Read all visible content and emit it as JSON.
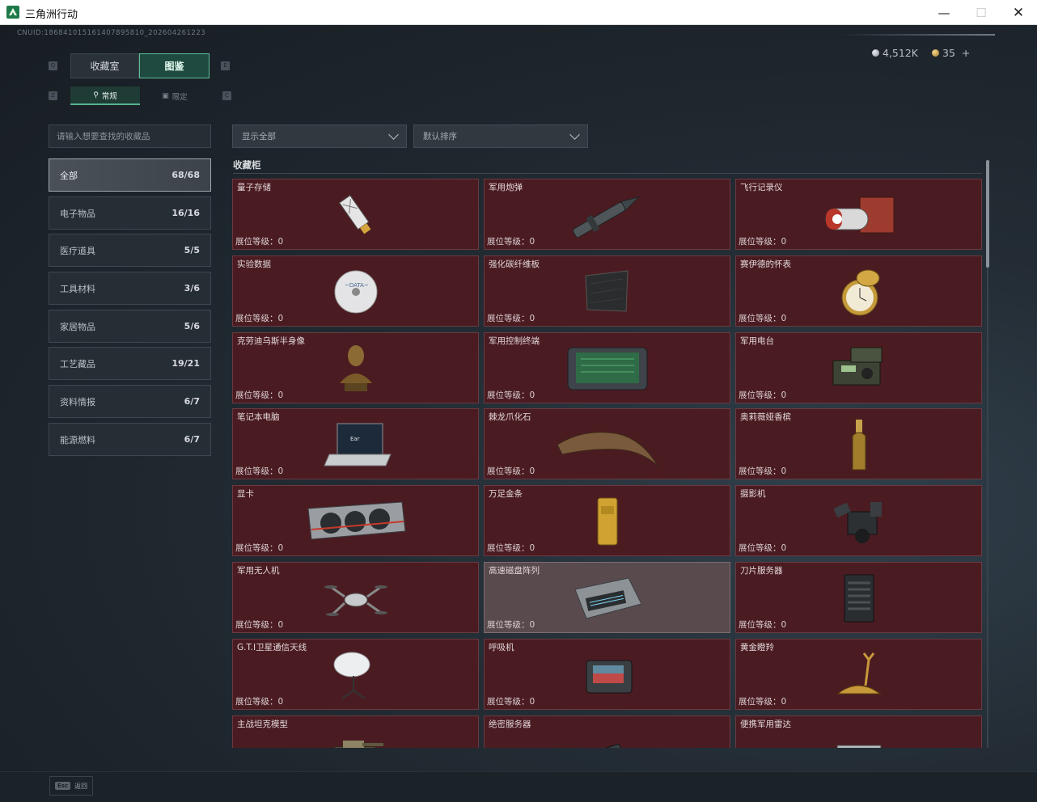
{
  "window": {
    "title": "三角洲行动",
    "min_label": "—",
    "max_label": "☐",
    "close_label": "✕"
  },
  "header": {
    "uid": "CNUID:186841015161407895810_202604261223",
    "silver": "4,512K",
    "gold": "35",
    "plus": "+"
  },
  "tabs": {
    "key_q": "Q",
    "key_e": "E",
    "key_z": "Z",
    "key_c": "C",
    "main": [
      "收藏室",
      "图鉴"
    ],
    "sub": [
      "常规",
      "限定"
    ],
    "sub_icons": [
      "trophy-icon",
      "box-icon"
    ]
  },
  "search": {
    "placeholder": "请输入想要查找的收藏品"
  },
  "filters": {
    "show": "显示全部",
    "sort": "默认排序"
  },
  "categories": [
    {
      "label": "全部",
      "count": "68/68",
      "active": true
    },
    {
      "label": "电子物品",
      "count": "16/16"
    },
    {
      "label": "医疗道具",
      "count": "5/5"
    },
    {
      "label": "工具材料",
      "count": "3/6"
    },
    {
      "label": "家居物品",
      "count": "5/6"
    },
    {
      "label": "工艺藏品",
      "count": "19/21"
    },
    {
      "label": "资料情报",
      "count": "6/7"
    },
    {
      "label": "能源燃料",
      "count": "6/7"
    }
  ],
  "section": {
    "title": "收藏柜"
  },
  "level_label": "展位等级：0",
  "items": [
    {
      "name": "量子存储",
      "icon": "usb-drive-icon"
    },
    {
      "name": "军用炮弹",
      "icon": "artillery-shell-icon"
    },
    {
      "name": "飞行记录仪",
      "icon": "flight-recorder-icon"
    },
    {
      "name": "实验数据",
      "icon": "disc-icon"
    },
    {
      "name": "强化碳纤维板",
      "icon": "carbon-plate-icon"
    },
    {
      "name": "赛伊德的怀表",
      "icon": "pocket-watch-icon"
    },
    {
      "name": "克劳迪乌斯半身像",
      "icon": "bust-icon"
    },
    {
      "name": "军用控制终端",
      "icon": "control-terminal-icon"
    },
    {
      "name": "军用电台",
      "icon": "radio-icon"
    },
    {
      "name": "笔记本电脑",
      "icon": "laptop-icon"
    },
    {
      "name": "棘龙爪化石",
      "icon": "claw-fossil-icon"
    },
    {
      "name": "奥莉薇娅香槟",
      "icon": "champagne-icon"
    },
    {
      "name": "显卡",
      "icon": "gpu-icon"
    },
    {
      "name": "万足金条",
      "icon": "gold-bar-icon"
    },
    {
      "name": "摄影机",
      "icon": "camera-icon"
    },
    {
      "name": "军用无人机",
      "icon": "drone-icon"
    },
    {
      "name": "高速磁盘阵列",
      "icon": "disk-array-icon",
      "highlighted": true
    },
    {
      "name": "刀片服务器",
      "icon": "blade-server-icon"
    },
    {
      "name": "G.T.I卫星通信天线",
      "icon": "satellite-dish-icon"
    },
    {
      "name": "呼吸机",
      "icon": "ventilator-icon"
    },
    {
      "name": "黄金瞪羚",
      "icon": "gold-gazelle-icon"
    },
    {
      "name": "主战坦克模型",
      "icon": "tank-model-icon"
    },
    {
      "name": "绝密服务器",
      "icon": "server-icon"
    },
    {
      "name": "便携军用雷达",
      "icon": "radar-icon"
    }
  ],
  "footer": {
    "esc_key": "Esc",
    "esc_label": "返回"
  }
}
